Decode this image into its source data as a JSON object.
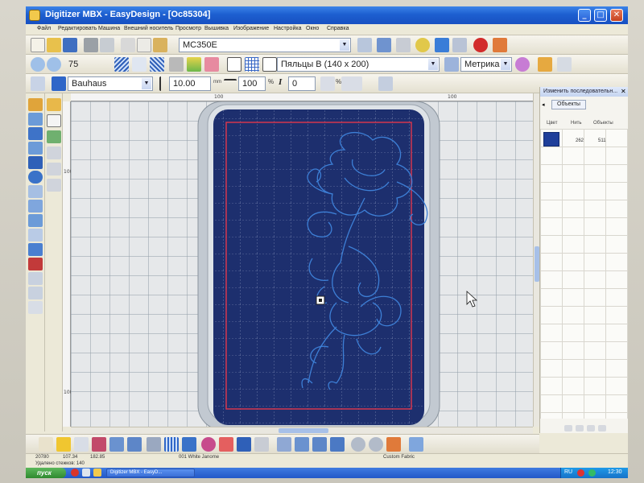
{
  "window": {
    "title": "Digitizer MBX - EasyDesign - [Oc85304]",
    "minimize": "_",
    "maximize": "□",
    "close": "✕"
  },
  "menu": [
    "Файл",
    "Редактировать",
    "Машина",
    "Внешний носитель",
    "Просмотр",
    "Вышивка",
    "Изображение",
    "Настройка",
    "Окно",
    "Справка"
  ],
  "toolbar1": {
    "machine": "MC350E"
  },
  "toolbar2": {
    "zoom": "75",
    "hoop": "Пяльцы B (140 x 200)",
    "units": "Метрика"
  },
  "toolbar3": {
    "font": "Bauhaus",
    "size": "10.00",
    "size_unit": "mm",
    "width": "100",
    "width_unit": "%",
    "italic_label": "I",
    "italic_value": "0",
    "spacing_unit": "%"
  },
  "ruler": {
    "h_top_1": "100",
    "h_top_2": "100",
    "v_left_1": "100",
    "v_left_2": "100"
  },
  "panel": {
    "title": "Изменить последовательн...",
    "tab": "Объекты",
    "columns": [
      "Цвет",
      "Нить",
      "Объекты"
    ],
    "rows": [
      {
        "thread": "262",
        "objects": "511",
        "color": "#1f3f9a"
      }
    ]
  },
  "status": {
    "coord1": "20780",
    "coord2": "107.34",
    "coord3": "182.85",
    "thread": "001 White Janome",
    "fabric": "Custom Fabric",
    "removed": "Удалено стежков: 140"
  },
  "taskbar": {
    "start": "пуск",
    "task": "Digitizer MBX - EasyD...",
    "lang": "RU",
    "time": "12:30"
  },
  "colors": {
    "hoop_bg": "#1d2f6e",
    "thread": "#3d7fd6",
    "safe_area": "#e0364b"
  }
}
